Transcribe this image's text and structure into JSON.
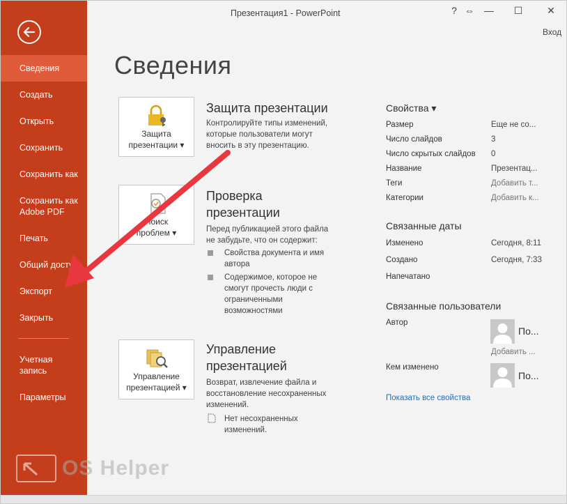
{
  "window": {
    "title": "Презентация1 - PowerPoint",
    "help": "?",
    "restore": "⇔",
    "minimize": "—",
    "maximize": "☐",
    "close": "✕",
    "signin": "Вход"
  },
  "sidebar": {
    "items": [
      {
        "label": "Сведения"
      },
      {
        "label": "Создать"
      },
      {
        "label": "Открыть"
      },
      {
        "label": "Сохранить"
      },
      {
        "label": "Сохранить как"
      },
      {
        "label": "Сохранить как\nAdobe PDF"
      },
      {
        "label": "Печать"
      },
      {
        "label": "Общий доступ"
      },
      {
        "label": "Экспорт"
      },
      {
        "label": "Закрыть"
      },
      {
        "label": "Учетная\nзапись"
      },
      {
        "label": "Параметры"
      }
    ]
  },
  "main": {
    "title": "Сведения",
    "sections": [
      {
        "tile_label": "Защита\nпрезентации ▾",
        "title": "Защита презентации",
        "text": "Контролируйте типы изменений, которые пользователи могут вносить в эту презентацию."
      },
      {
        "tile_label": "Поиск\nпроблем ▾",
        "title": "Проверка\nпрезентации",
        "text": "Перед публикацией этого файла не забудьте, что он содержит:",
        "bullets": [
          "Свойства документа и имя автора",
          "Содержимое, которое не смогут прочесть люди с ограниченными возможностями"
        ]
      },
      {
        "tile_label": "Управление\nпрезентацией ▾",
        "title": "Управление\nпрезентацией",
        "text": "Возврат, извлечение файла и восстановление несохраненных изменений.",
        "note": "Нет несохраненных изменений."
      }
    ]
  },
  "properties": {
    "header": "Свойства ▾",
    "rows": [
      {
        "label": "Размер",
        "value": "Еще не со..."
      },
      {
        "label": "Число слайдов",
        "value": "3"
      },
      {
        "label": "Число скрытых слайдов",
        "value": "0"
      },
      {
        "label": "Название",
        "value": "Презентац..."
      },
      {
        "label": "Теги",
        "value": "Добавить т..."
      },
      {
        "label": "Категории",
        "value": "Добавить к..."
      }
    ],
    "dates_title": "Связанные даты",
    "dates": [
      {
        "label": "Изменено",
        "value": "Сегодня, 8:11"
      },
      {
        "label": "Создано",
        "value": "Сегодня, 7:33"
      },
      {
        "label": "Напечатано",
        "value": ""
      }
    ],
    "people_title": "Связанные пользователи",
    "author_label": "Автор",
    "author_name": "По...",
    "add_author": "Добавить ...",
    "modified_by_label": "Кем изменено",
    "modified_by_name": "По...",
    "show_all": "Показать все свойства"
  },
  "watermark": {
    "text": "OS Helper"
  },
  "colors": {
    "sidebar": "#c43e1c",
    "sidebar_active": "#e05b39",
    "arrow": "#e8373f"
  }
}
